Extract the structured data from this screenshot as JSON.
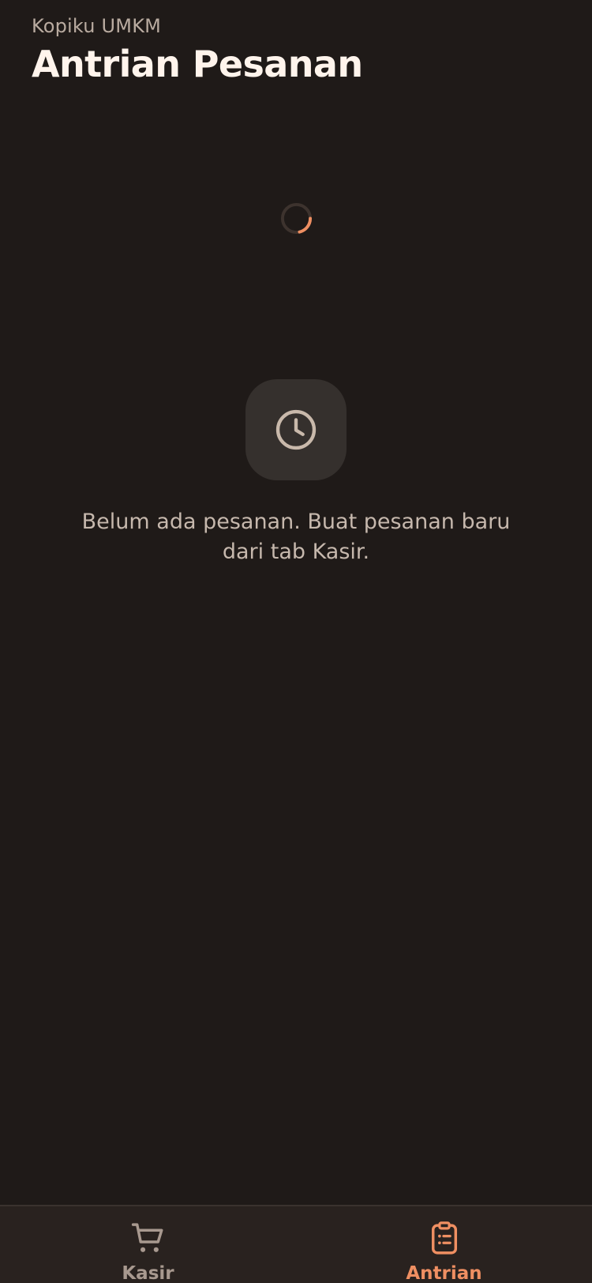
{
  "header": {
    "app_name": "Kopiku UMKM",
    "title": "Antrian Pesanan"
  },
  "loading": {
    "icon": "loading-spinner-icon"
  },
  "empty_state": {
    "icon": "clock-icon",
    "message": "Belum ada pesanan. Buat pesanan baru dari tab Kasir."
  },
  "bottom_nav": {
    "tabs": [
      {
        "label": "Kasir",
        "icon": "shopping-cart-icon",
        "active": false
      },
      {
        "label": "Antrian",
        "icon": "clipboard-list-icon",
        "active": true
      }
    ]
  },
  "colors": {
    "background": "#1f1a18",
    "accent": "#ef8f62",
    "muted": "#a8998f",
    "title": "#fff4ec",
    "nav_background": "#29221f"
  }
}
